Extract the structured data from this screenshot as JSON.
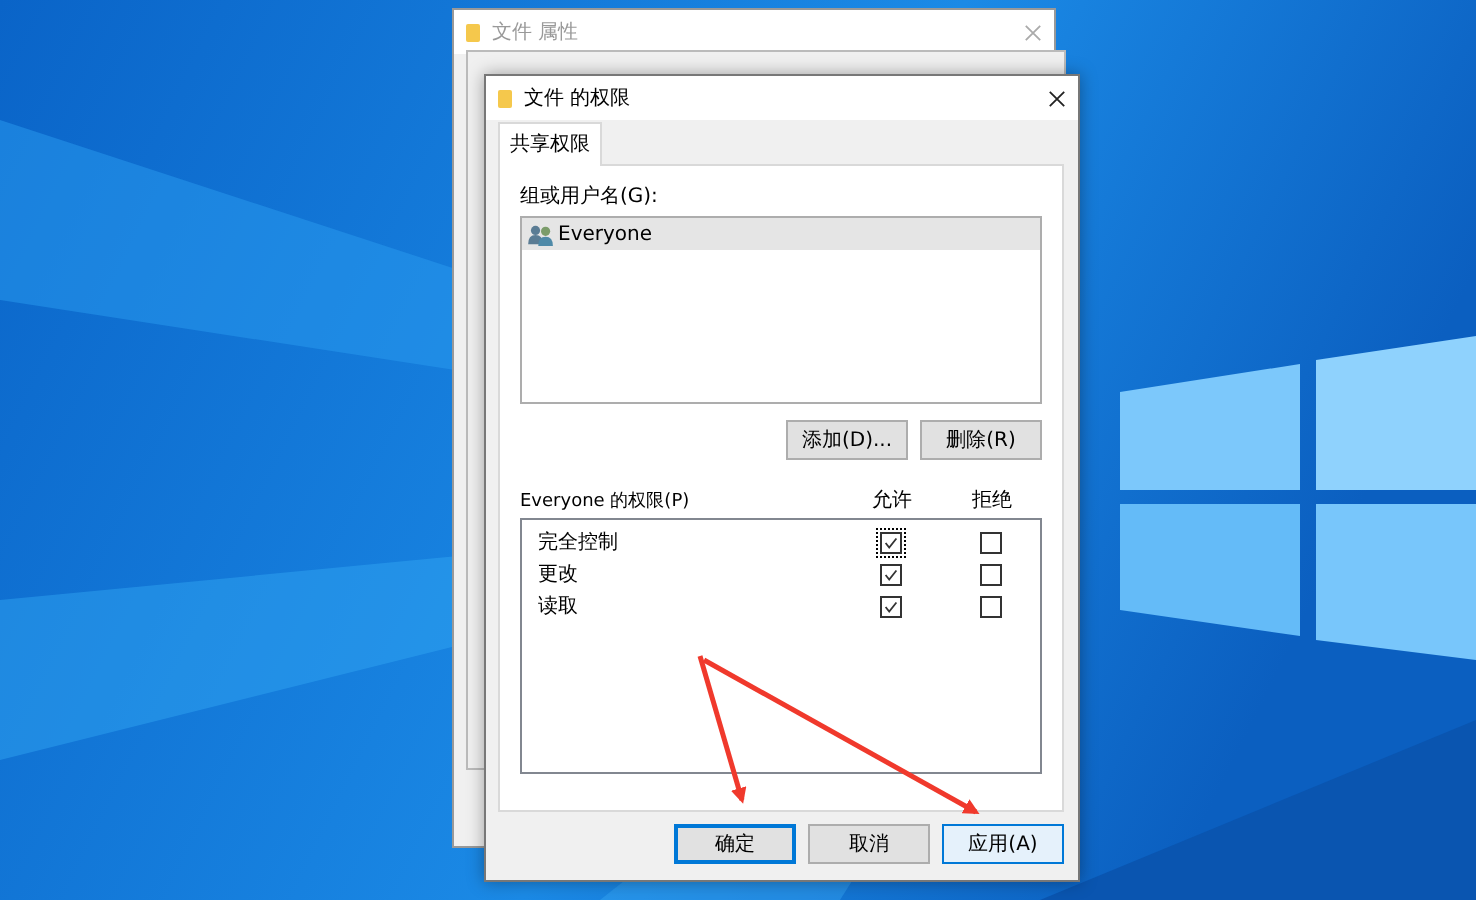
{
  "back_window": {
    "title": "文件 属性"
  },
  "dialog": {
    "title": "文件 的权限",
    "tabs": [
      {
        "label": "共享权限",
        "selected": true
      }
    ],
    "group_label": "组或用户名(G):",
    "users": [
      {
        "name": "Everyone",
        "selected": true
      }
    ],
    "user_buttons": [
      "添加(D)...",
      "删除(R)"
    ],
    "permissions_label": "Everyone 的权限(P)",
    "allow_header": "允许",
    "deny_header": "拒绝",
    "permissions": [
      {
        "name": "完全控制",
        "allow": true,
        "deny": false,
        "focused": true
      },
      {
        "name": "更改",
        "allow": true,
        "deny": false,
        "focused": false
      },
      {
        "name": "读取",
        "allow": true,
        "deny": false,
        "focused": false
      }
    ],
    "buttons": [
      {
        "label": "确定",
        "default": true,
        "hot": false
      },
      {
        "label": "取消",
        "default": false,
        "hot": false
      },
      {
        "label": "应用(A)",
        "default": false,
        "hot": true
      }
    ]
  }
}
